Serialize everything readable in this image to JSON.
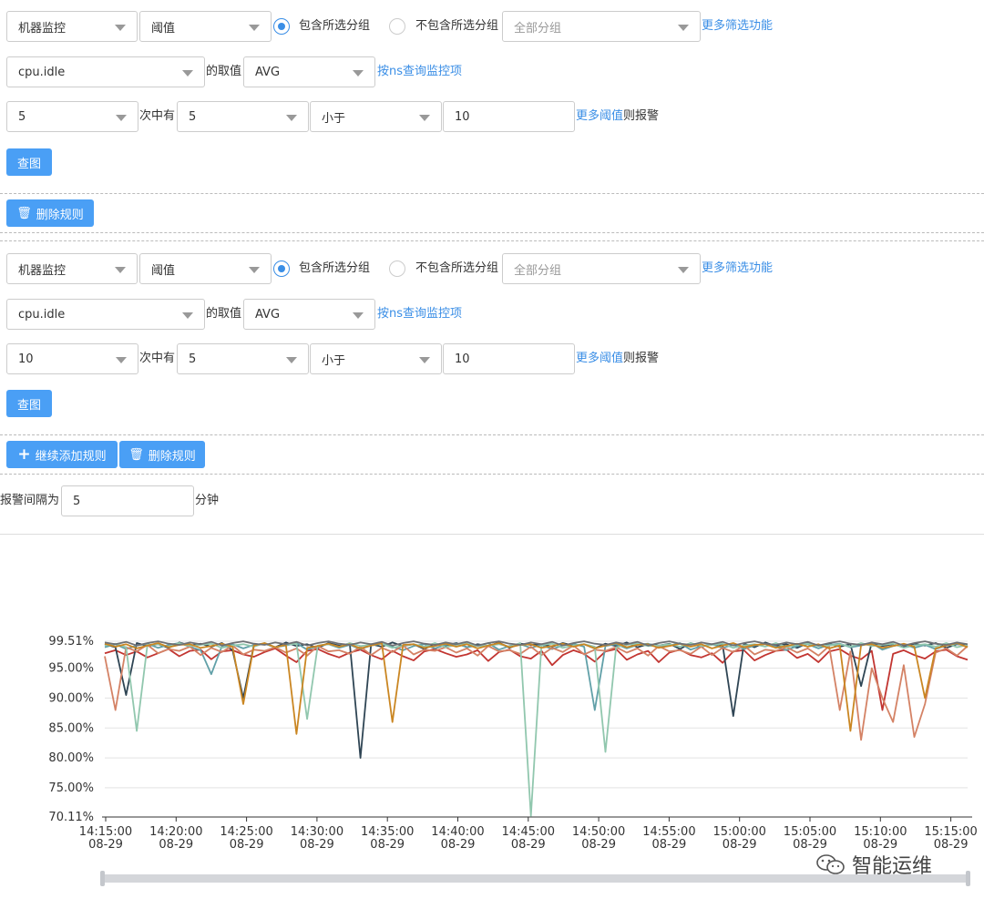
{
  "rule1": {
    "monitor_type": "机器监控",
    "rule_type": "阈值",
    "include_label": "包含所选分组",
    "exclude_label": "不包含所选分组",
    "group_placeholder": "全部分组",
    "more_filters": "更多筛选功能",
    "metric": "cpu.idle",
    "of_value": "的取值",
    "aggregation": "AVG",
    "ns_query": "按ns查询监控项",
    "times_total": "5",
    "times_in": "次中有",
    "times_hit": "5",
    "operator": "小于",
    "threshold": "10",
    "more_threshold": "更多阈值",
    "then_alert": "则报警",
    "view_chart": "查图",
    "delete_rule": "删除规则"
  },
  "rule2": {
    "monitor_type": "机器监控",
    "rule_type": "阈值",
    "include_label": "包含所选分组",
    "exclude_label": "不包含所选分组",
    "group_placeholder": "全部分组",
    "more_filters": "更多筛选功能",
    "metric": "cpu.idle",
    "of_value": "的取值",
    "aggregation": "AVG",
    "ns_query": "按ns查询监控项",
    "times_total": "10",
    "times_in": "次中有",
    "times_hit": "5",
    "operator": "小于",
    "threshold": "10",
    "more_threshold": "更多阈值",
    "then_alert": "则报警",
    "view_chart": "查图",
    "add_rule": "继续添加规则",
    "delete_rule": "删除规则"
  },
  "interval": {
    "label": "报警间隔为",
    "value": "5",
    "unit": "分钟"
  },
  "watermark": "智能运维",
  "chart_data": {
    "type": "line",
    "y_tick_labels": [
      "99.51%",
      "95.00%",
      "90.00%",
      "85.00%",
      "80.00%",
      "75.00%",
      "70.11%"
    ],
    "y_ticks": [
      99.51,
      95,
      90,
      85,
      80,
      75,
      70.11
    ],
    "ylim": [
      70.11,
      99.51
    ],
    "x_ticks": [
      {
        "time": "14:15:00",
        "date": "08-29"
      },
      {
        "time": "14:20:00",
        "date": "08-29"
      },
      {
        "time": "14:25:00",
        "date": "08-29"
      },
      {
        "time": "14:30:00",
        "date": "08-29"
      },
      {
        "time": "14:35:00",
        "date": "08-29"
      },
      {
        "time": "14:40:00",
        "date": "08-29"
      },
      {
        "time": "14:45:00",
        "date": "08-29"
      },
      {
        "time": "14:50:00",
        "date": "08-29"
      },
      {
        "time": "14:55:00",
        "date": "08-29"
      },
      {
        "time": "15:00:00",
        "date": "08-29"
      },
      {
        "time": "15:05:00",
        "date": "08-29"
      },
      {
        "time": "15:10:00",
        "date": "08-29"
      },
      {
        "time": "15:15:00",
        "date": "08-29"
      }
    ],
    "series": [
      {
        "color": "#c23531",
        "values": [
          97.5,
          98.0,
          97.2,
          97.8,
          96.8,
          97.5,
          98.2,
          97.0,
          97.9,
          98.1,
          96.5,
          97.8,
          98.0,
          97.3,
          96.9,
          97.7,
          98.3,
          97.1,
          96.0,
          97.9,
          98.2,
          97.4,
          96.8,
          97.6,
          98.1,
          97.2,
          96.5,
          97.9,
          97.0,
          96.3,
          97.8,
          98.2,
          97.5,
          96.9,
          97.3,
          98.0,
          96.2,
          97.7,
          98.1,
          97.0,
          96.6,
          97.9,
          95.5,
          97.2,
          98.0,
          97.4,
          96.1,
          97.8,
          98.2,
          96.4,
          97.3,
          97.9,
          96.0,
          97.6,
          98.1,
          97.2,
          96.8,
          97.5,
          95.9,
          97.8,
          98.0,
          96.3,
          97.2,
          97.9,
          98.1,
          96.7,
          97.4,
          96.0,
          97.8,
          98.2,
          97.1,
          96.5,
          97.9,
          88.0,
          97.4,
          98.0,
          97.2,
          96.6,
          97.8,
          98.1,
          97.0,
          96.4
        ]
      },
      {
        "color": "#2f4554",
        "values": [
          99.0,
          98.5,
          90.5,
          99.2,
          98.7,
          99.0,
          98.4,
          99.3,
          98.8,
          99.1,
          98.6,
          99.2,
          98.0,
          90.0,
          98.9,
          99.1,
          98.5,
          99.3,
          98.7,
          99.0,
          98.4,
          99.2,
          98.8,
          99.1,
          80.0,
          99.0,
          98.6,
          99.3,
          98.7,
          99.0,
          98.2,
          99.1,
          98.8,
          99.2,
          98.5,
          99.0,
          98.7,
          99.3,
          98.4,
          99.1,
          98.9,
          99.0,
          98.6,
          99.2,
          98.8,
          99.0,
          98.3,
          99.1,
          98.7,
          99.3,
          98.5,
          99.0,
          98.8,
          99.1,
          98.2,
          99.2,
          98.6,
          99.0,
          98.9,
          87.0,
          99.1,
          98.5,
          99.3,
          98.7,
          99.0,
          98.4,
          99.2,
          98.8,
          99.1,
          98.6,
          99.0,
          92.0,
          99.3,
          98.7,
          99.0,
          98.5,
          99.1,
          98.8,
          99.2,
          98.4,
          99.0,
          98.9
        ]
      },
      {
        "color": "#61a0a8",
        "values": [
          98.5,
          99.0,
          98.2,
          98.8,
          99.1,
          98.4,
          98.9,
          99.2,
          98.6,
          98.0,
          94.0,
          98.7,
          99.0,
          98.3,
          98.9,
          99.1,
          98.5,
          98.8,
          99.2,
          98.1,
          98.7,
          99.0,
          98.4,
          98.9,
          98.2,
          98.8,
          99.1,
          98.6,
          98.0,
          98.7,
          99.0,
          98.3,
          98.9,
          99.1,
          98.5,
          98.8,
          99.2,
          98.1,
          98.7,
          99.0,
          98.4,
          98.9,
          98.2,
          98.8,
          99.1,
          98.6,
          88.0,
          98.7,
          99.0,
          98.3,
          98.9,
          99.1,
          98.5,
          98.8,
          99.2,
          98.1,
          98.7,
          99.0,
          98.4,
          98.9,
          98.2,
          98.8,
          99.1,
          98.6,
          98.0,
          98.7,
          99.0,
          98.3,
          98.9,
          99.1,
          98.5,
          98.8,
          99.2,
          98.1,
          98.7,
          99.0,
          98.4,
          98.9,
          98.2,
          98.8,
          99.1,
          98.6
        ]
      },
      {
        "color": "#d48265",
        "values": [
          97.0,
          88.0,
          98.5,
          97.8,
          98.9,
          97.5,
          98.2,
          97.9,
          98.6,
          97.2,
          98.4,
          97.7,
          98.8,
          97.3,
          98.1,
          97.9,
          98.5,
          97.6,
          98.3,
          97.1,
          98.7,
          97.8,
          98.0,
          97.4,
          98.6,
          97.2,
          98.4,
          97.7,
          98.8,
          97.3,
          98.1,
          97.9,
          98.5,
          97.6,
          98.3,
          97.1,
          98.7,
          97.8,
          98.0,
          97.4,
          98.6,
          97.2,
          98.4,
          97.7,
          98.8,
          97.3,
          98.1,
          97.9,
          98.5,
          97.6,
          98.3,
          97.1,
          98.7,
          97.8,
          98.0,
          97.4,
          98.6,
          97.2,
          98.4,
          97.7,
          98.8,
          97.3,
          98.1,
          97.9,
          98.5,
          97.6,
          98.3,
          97.1,
          98.7,
          88.0,
          97.8,
          83.0,
          95.0,
          90.0,
          86.0,
          95.5,
          83.5,
          89.0,
          97.6,
          98.3,
          97.1,
          98.7
        ]
      },
      {
        "color": "#91c7ae",
        "values": [
          98.8,
          99.1,
          98.5,
          84.5,
          98.9,
          99.0,
          98.6,
          99.2,
          98.7,
          98.9,
          99.1,
          98.4,
          98.8,
          99.0,
          98.6,
          99.2,
          98.5,
          98.9,
          99.1,
          86.5,
          98.8,
          99.0,
          98.6,
          99.2,
          98.7,
          98.9,
          99.1,
          98.4,
          98.8,
          99.0,
          98.6,
          99.2,
          98.5,
          98.9,
          99.1,
          98.7,
          98.8,
          99.0,
          98.6,
          99.2,
          70.3,
          98.9,
          99.1,
          98.4,
          98.8,
          99.0,
          98.6,
          81.0,
          98.5,
          98.9,
          99.1,
          98.7,
          98.8,
          99.0,
          98.6,
          99.2,
          98.7,
          98.9,
          99.1,
          98.4,
          98.8,
          99.0,
          98.6,
          99.2,
          98.5,
          98.9,
          99.1,
          98.7,
          98.8,
          99.0,
          98.6,
          99.2,
          98.7,
          98.9,
          99.1,
          98.4,
          98.8,
          99.0,
          98.6,
          99.2,
          98.5,
          98.9
        ]
      },
      {
        "color": "#ca8622",
        "values": [
          99.1,
          98.6,
          99.0,
          98.3,
          98.8,
          99.2,
          98.5,
          98.9,
          99.0,
          98.4,
          98.7,
          99.1,
          98.6,
          89.0,
          98.8,
          99.2,
          98.5,
          98.9,
          84.0,
          98.4,
          98.7,
          99.1,
          98.6,
          99.0,
          98.3,
          98.8,
          99.2,
          86.0,
          98.9,
          99.0,
          98.4,
          98.7,
          99.1,
          98.6,
          99.0,
          98.3,
          98.8,
          99.2,
          98.5,
          98.9,
          99.0,
          98.4,
          98.7,
          99.1,
          98.6,
          99.0,
          98.3,
          98.8,
          99.2,
          98.5,
          98.9,
          99.0,
          98.4,
          98.7,
          99.1,
          98.6,
          99.0,
          98.3,
          98.8,
          99.2,
          98.5,
          98.9,
          99.0,
          98.4,
          98.7,
          99.1,
          98.6,
          99.0,
          98.3,
          98.8,
          84.5,
          98.9,
          99.0,
          98.4,
          98.7,
          99.1,
          98.6,
          90.0,
          98.3,
          98.8,
          99.2,
          98.5
        ]
      },
      {
        "color": "#6e7074",
        "values": [
          99.3,
          99.0,
          99.4,
          98.8,
          99.2,
          99.5,
          99.1,
          98.9,
          99.3,
          99.0,
          99.4,
          98.8,
          99.2,
          99.5,
          99.1,
          98.9,
          99.3,
          99.0,
          99.4,
          98.8,
          99.2,
          99.5,
          99.1,
          98.9,
          99.3,
          99.0,
          99.4,
          98.8,
          99.2,
          99.5,
          99.1,
          98.9,
          99.3,
          99.0,
          99.4,
          98.8,
          99.2,
          99.5,
          99.1,
          98.9,
          99.3,
          99.0,
          99.4,
          98.8,
          99.2,
          99.5,
          99.1,
          98.9,
          99.3,
          99.0,
          99.4,
          98.8,
          99.2,
          99.5,
          99.1,
          98.9,
          99.3,
          99.0,
          99.4,
          98.8,
          99.2,
          99.5,
          99.1,
          98.9,
          99.3,
          99.0,
          99.4,
          98.8,
          99.2,
          99.5,
          99.1,
          98.9,
          99.3,
          99.0,
          99.4,
          98.8,
          99.2,
          99.5,
          99.1,
          98.9,
          99.3,
          99.0
        ]
      }
    ]
  }
}
